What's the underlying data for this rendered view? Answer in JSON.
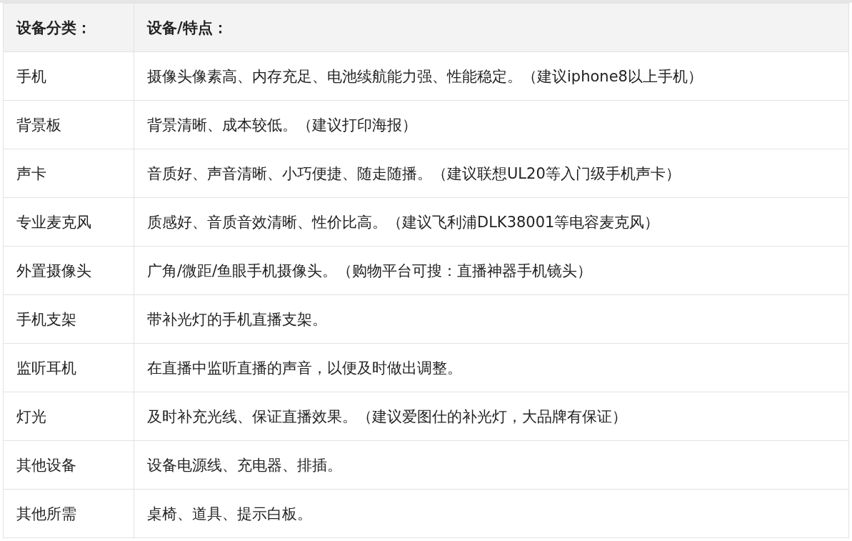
{
  "table": {
    "columns": [
      "设备分类：",
      "设备/特点："
    ],
    "rows": [
      {
        "category": "手机",
        "features": "摄像头像素高、内存充足、电池续航能力强、性能稳定。（建议iphone8以上手机）"
      },
      {
        "category": "背景板",
        "features": "背景清晰、成本较低。（建议打印海报）"
      },
      {
        "category": "声卡",
        "features": "音质好、声音清晰、小巧便捷、随走随播。（建议联想UL20等入门级手机声卡）"
      },
      {
        "category": "专业麦克风",
        "features": "质感好、音质音效清晰、性价比高。（建议飞利浦DLK38001等电容麦克风）"
      },
      {
        "category": "外置摄像头",
        "features": "广角/微距/鱼眼手机摄像头。（购物平台可搜：直播神器手机镜头）"
      },
      {
        "category": "手机支架",
        "features": "带补光灯的手机直播支架。"
      },
      {
        "category": "监听耳机",
        "features": "在直播中监听直播的声音，以便及时做出调整。"
      },
      {
        "category": "灯光",
        "features": "及时补充光线、保证直播效果。（建议爱图仕的补光灯，大品牌有保证）"
      },
      {
        "category": "其他设备",
        "features": "设备电源线、充电器、排插。"
      },
      {
        "category": "其他所需",
        "features": "桌椅、道具、提示白板。"
      }
    ]
  }
}
